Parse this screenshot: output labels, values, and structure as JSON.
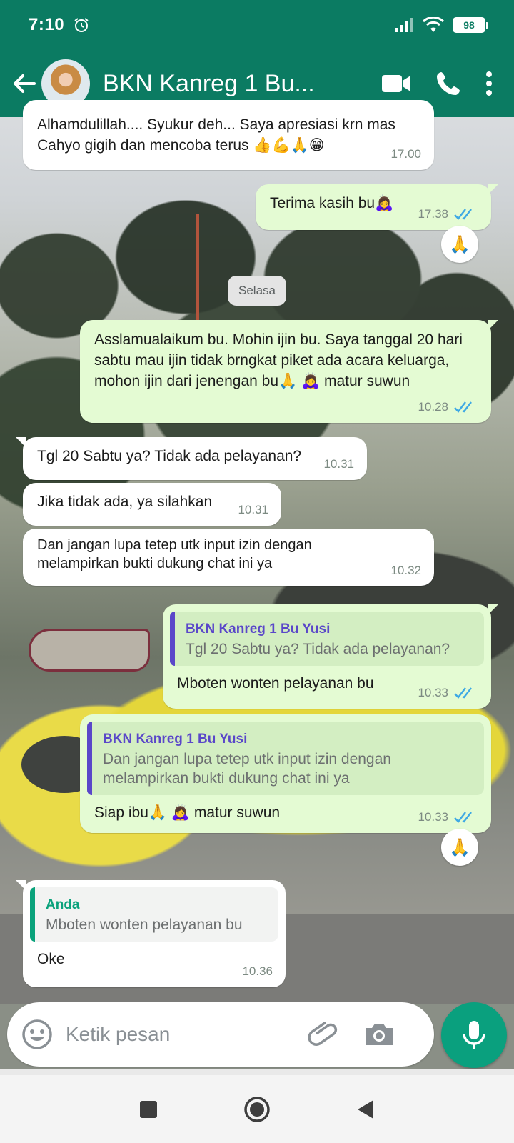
{
  "status_bar": {
    "time": "7:10",
    "battery": "98"
  },
  "header": {
    "title": "BKN Kanreg 1 Bu..."
  },
  "date_separator": "Selasa",
  "messages": [
    {
      "dir": "in",
      "text": "Alhamdulillah.... Syukur deh... Saya apresiasi krn mas Cahyo gigih dan mencoba terus 👍💪🙏😁",
      "time": "17.00"
    },
    {
      "dir": "out",
      "text": "Terima kasih bu🙇‍♀️",
      "time": "17.38",
      "reaction": "🙏"
    },
    {
      "dir": "out",
      "text": "Asslamualaikum bu.  Mohin ijin bu.  Saya tanggal 20 hari sabtu mau ijin tidak brngkat piket ada acara keluarga, mohon ijin dari jenengan bu🙏 🙇‍♀️ matur suwun",
      "time": "10.28"
    },
    {
      "dir": "in",
      "text": "Tgl 20 Sabtu ya? Tidak ada pelayanan?",
      "time": "10.31"
    },
    {
      "dir": "in",
      "text": "Jika tidak ada, ya silahkan",
      "time": "10.31"
    },
    {
      "dir": "in",
      "text": "Dan jangan lupa tetep utk input izin dengan melampirkan bukti dukung chat ini ya",
      "time": "10.32"
    },
    {
      "dir": "out",
      "quote_author": "BKN Kanreg 1 Bu Yusi",
      "quote_text": "Tgl 20 Sabtu ya? Tidak ada pelayanan?",
      "text": "Mboten  wonten pelayanan bu",
      "time": "10.33"
    },
    {
      "dir": "out",
      "quote_author": "BKN Kanreg 1 Bu Yusi",
      "quote_text": "Dan jangan lupa tetep utk input izin dengan melampirkan bukti dukung chat ini ya",
      "text": "Siap ibu🙏 🙇‍♀️ matur suwun",
      "time": "10.33",
      "reaction": "🙏"
    },
    {
      "dir": "in",
      "quote_author": "Anda",
      "quote_text": "Mboten  wonten pelayanan bu",
      "text": "Oke",
      "time": "10.36"
    }
  ],
  "composer": {
    "placeholder": "Ketik pesan"
  },
  "colors": {
    "header": "#0b7b62",
    "outgoing_bubble": "#e4fbd3",
    "incoming_bubble": "#ffffff",
    "read_ticks": "#3fa9e4",
    "mic_button": "#0aa07e"
  },
  "icons": {
    "back": "arrow-left-icon",
    "video": "video-camera-icon",
    "call": "phone-icon",
    "menu": "more-vertical-icon",
    "emoji": "smiley-icon",
    "attach": "paperclip-icon",
    "camera": "camera-icon",
    "mic": "microphone-icon"
  }
}
